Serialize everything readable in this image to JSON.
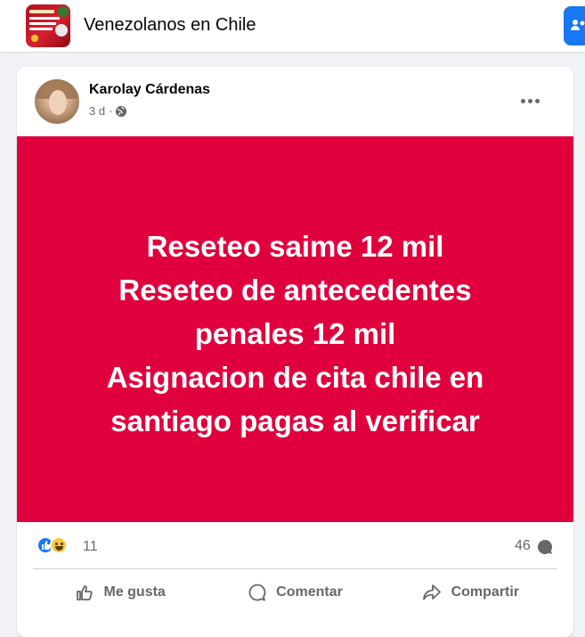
{
  "header": {
    "group_title": "Venezolanos en Chile",
    "group_thumb_icon": "group-cover-thumbnail",
    "corner_button_icon": "people-icon"
  },
  "post": {
    "author": "Karolay Cárdenas",
    "time": "3 d",
    "separator": "·",
    "privacy_icon": "globe-icon",
    "more_icon": "more-dots-icon",
    "background_color": "#e0003d",
    "text": "Reseteo saime 12 mil\nReseteo de antecedentes\npenales 12 mil\nAsignacion de cita chile en\nsantiago pagas al verificar"
  },
  "stats": {
    "reaction_count": "11",
    "comment_count": "46"
  },
  "actions": {
    "like_label": "Me gusta",
    "comment_label": "Comentar",
    "share_label": "Compartir"
  },
  "colors": {
    "accent": "#1877f2",
    "muted_text": "#65676b"
  }
}
